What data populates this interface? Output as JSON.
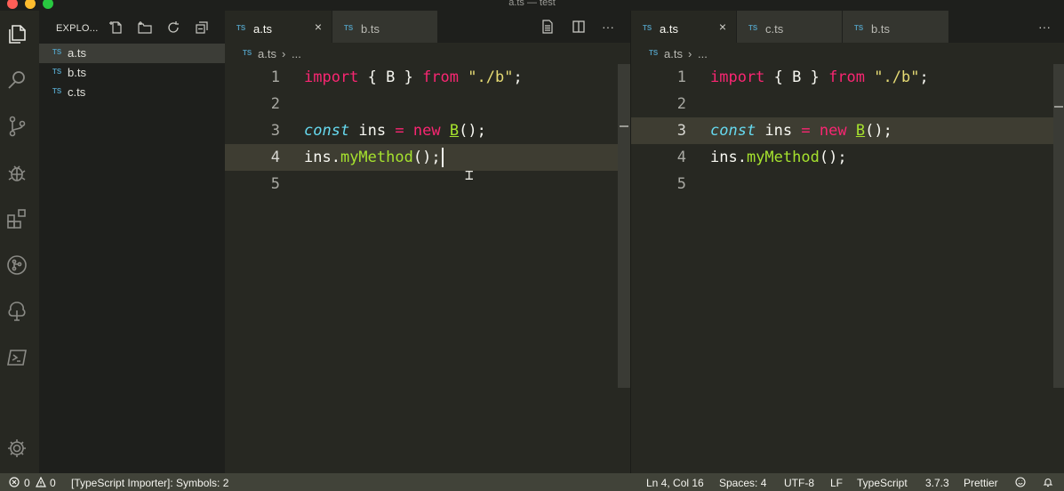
{
  "window": {
    "title": "a.ts — test"
  },
  "sidebar": {
    "title": "EXPLO...",
    "files": [
      {
        "badge": "TS",
        "name": "a.ts"
      },
      {
        "badge": "TS",
        "name": "b.ts"
      },
      {
        "badge": "TS",
        "name": "c.ts"
      }
    ]
  },
  "editor_left": {
    "tabs": [
      {
        "badge": "TS",
        "name": "a.ts",
        "close": "×"
      },
      {
        "badge": "TS",
        "name": "b.ts"
      }
    ],
    "more": "···",
    "breadcrumb": {
      "badge": "TS",
      "file": "a.ts",
      "sep": "›",
      "rest": "..."
    },
    "line_numbers": [
      "1",
      "2",
      "3",
      "4",
      "5"
    ],
    "lines": {
      "l1": {
        "kw_import": "import",
        "p1": " { B } ",
        "kw_from": "from",
        "p2": " ",
        "str": "\"./b\"",
        "p3": ";"
      },
      "l3": {
        "kw_const": "const",
        "p1": " ins ",
        "eq": "=",
        "p2": " ",
        "kw_new": "new",
        "p3": " ",
        "cls": "B",
        "p4": "();"
      },
      "l4": {
        "p1": "ins.",
        "fn": "myMethod",
        "p2": "();"
      }
    }
  },
  "editor_right": {
    "tabs": [
      {
        "badge": "TS",
        "name": "a.ts",
        "close": "×"
      },
      {
        "badge": "TS",
        "name": "c.ts"
      },
      {
        "badge": "TS",
        "name": "b.ts"
      }
    ],
    "more": "···",
    "breadcrumb": {
      "badge": "TS",
      "file": "a.ts",
      "sep": "›",
      "rest": "..."
    },
    "line_numbers": [
      "1",
      "2",
      "3",
      "4",
      "5"
    ],
    "lines": {
      "l1": {
        "kw_import": "import",
        "p1": " { B } ",
        "kw_from": "from",
        "p2": " ",
        "str": "\"./b\"",
        "p3": ";"
      },
      "l3": {
        "kw_const": "const",
        "p1": " ins ",
        "eq": "=",
        "p2": " ",
        "kw_new": "new",
        "p3": " ",
        "cls": "B",
        "p4": "();"
      },
      "l4": {
        "p1": "ins.",
        "fn": "myMethod",
        "p2": "();"
      }
    }
  },
  "statusbar": {
    "errors": "0",
    "warnings": "0",
    "message": "[TypeScript Importer]: Symbols: 2",
    "position": "Ln 4, Col 16",
    "spaces": "Spaces: 4",
    "encoding": "UTF-8",
    "eol": "LF",
    "language": "TypeScript",
    "version": "3.7.3",
    "formatter": "Prettier"
  },
  "colors": {
    "keyword": "#f92672",
    "string": "#e6db74",
    "storage": "#66d9ef",
    "function": "#a6e22e",
    "ts_badge": "#519aba",
    "statusbar": "#414339"
  }
}
